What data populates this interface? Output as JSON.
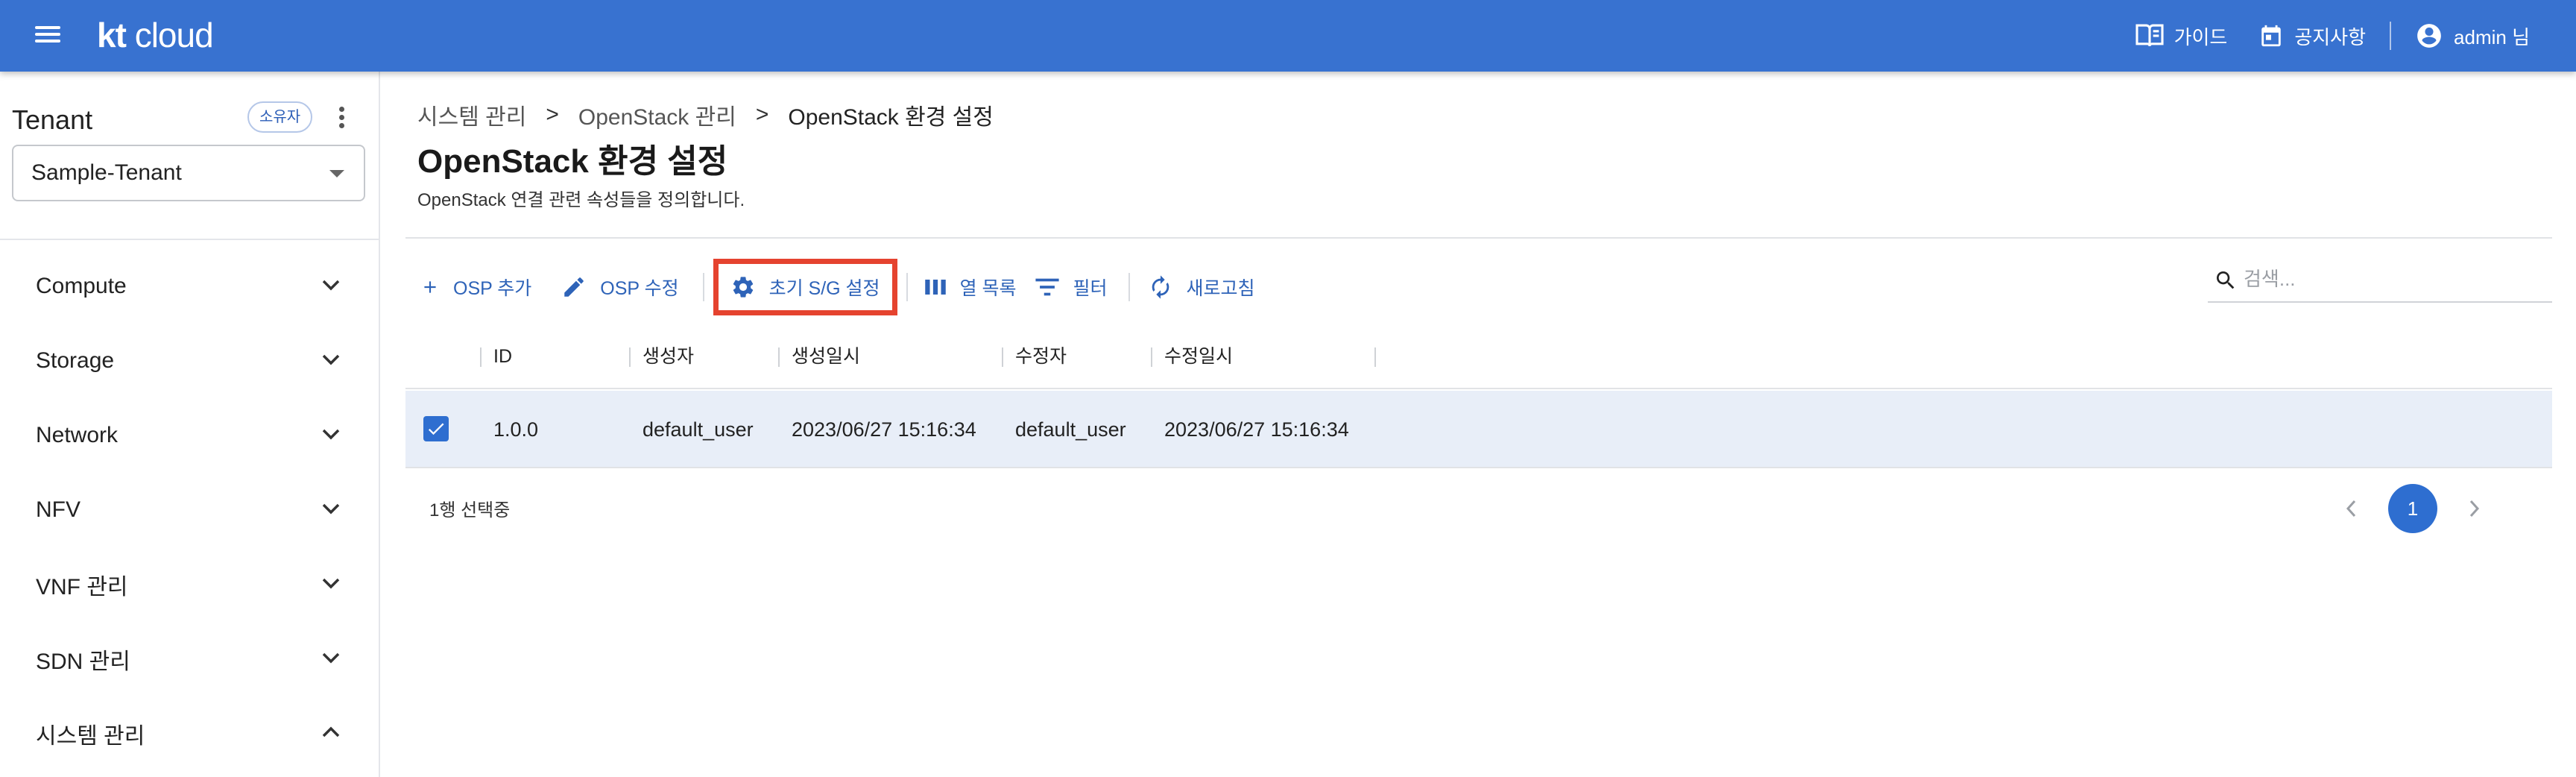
{
  "header": {
    "logo_kt": "kt",
    "logo_cloud": "cloud",
    "guide_label": "가이드",
    "notice_label": "공지사항",
    "user_label": "admin 님"
  },
  "sidebar": {
    "tenant_title": "Tenant",
    "owner_badge": "소유자",
    "tenant_selected": "Sample-Tenant",
    "items": [
      {
        "label": "Compute",
        "expanded": false
      },
      {
        "label": "Storage",
        "expanded": false
      },
      {
        "label": "Network",
        "expanded": false
      },
      {
        "label": "NFV",
        "expanded": false
      },
      {
        "label": "VNF 관리",
        "expanded": false
      },
      {
        "label": "SDN 관리",
        "expanded": false
      },
      {
        "label": "시스템 관리",
        "expanded": true
      }
    ]
  },
  "breadcrumb": {
    "items": [
      "시스템 관리",
      "OpenStack 관리",
      "OpenStack 환경 설정"
    ],
    "separator": ">"
  },
  "page": {
    "title": "OpenStack 환경 설정",
    "description": "OpenStack 연결 관련 속성들을 정의합니다."
  },
  "toolbar": {
    "add_label": "OSP 추가",
    "edit_label": "OSP 수정",
    "init_sg_label": "초기 S/G 설정",
    "columns_label": "열 목록",
    "filter_label": "필터",
    "refresh_label": "새로고침",
    "search_placeholder": "검색..."
  },
  "table": {
    "columns": [
      "ID",
      "생성자",
      "생성일시",
      "수정자",
      "수정일시"
    ],
    "rows": [
      {
        "selected": true,
        "cells": [
          "1.0.0",
          "default_user",
          "2023/06/27 15:16:34",
          "default_user",
          "2023/06/27 15:16:34"
        ]
      }
    ],
    "selection_info": "1행 선택중"
  },
  "pagination": {
    "current_page": "1",
    "prev_icon": "chevron-left-icon",
    "next_icon": "chevron-right-icon"
  },
  "colors": {
    "primary": "#3872d0",
    "accent_text": "#2e63b8",
    "selected_row": "#e8eef8",
    "highlight_box": "#e5432f"
  }
}
